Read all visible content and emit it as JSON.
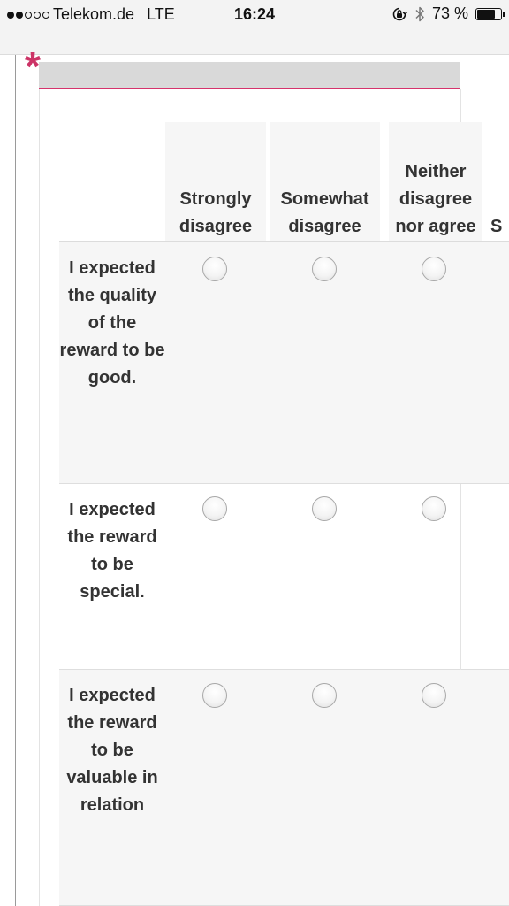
{
  "status_bar": {
    "signal_dots_filled": 2,
    "signal_dots_total": 5,
    "carrier": "Telekom.de",
    "network": "LTE",
    "time": "16:24",
    "battery_percent": "73 %",
    "battery_level": 0.73,
    "icons": [
      "rotation-lock-icon",
      "bluetooth-icon",
      "battery-icon"
    ]
  },
  "question": {
    "required_marker": "*",
    "accent_color": "#cc3366"
  },
  "columns": [
    {
      "label": "Strongly disagree"
    },
    {
      "label": "Somewhat disagree"
    },
    {
      "label": "Neither disagree nor agree"
    },
    {
      "label": "S"
    }
  ],
  "rows": [
    {
      "label": "I expected the quality of the reward to be good."
    },
    {
      "label": "I expected the reward to be special."
    },
    {
      "label": "I expected the reward to be valuable in relation"
    }
  ]
}
